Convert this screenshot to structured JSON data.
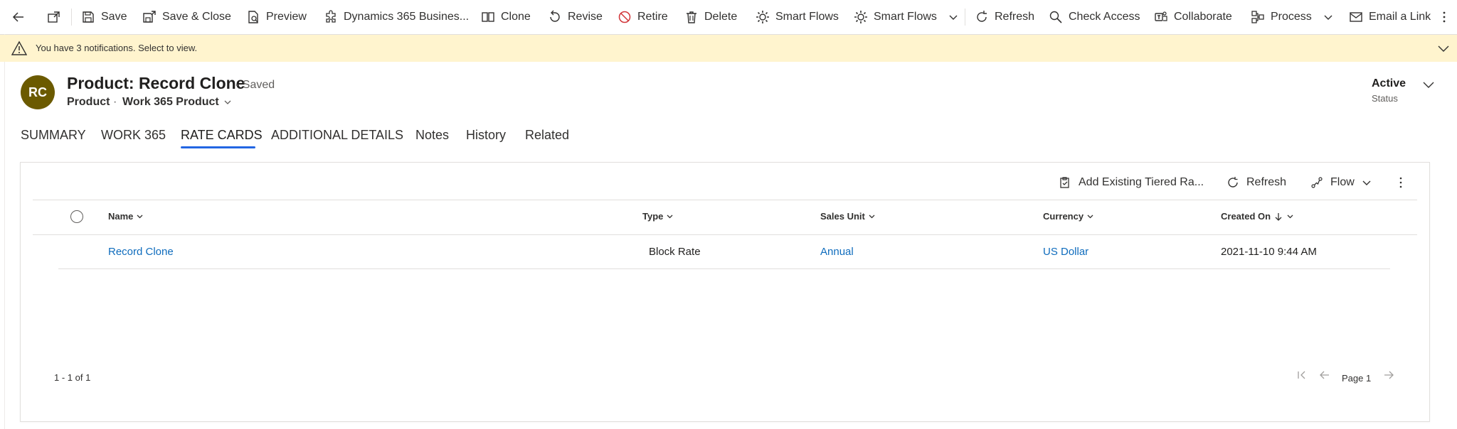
{
  "commands": [
    {
      "label": "Save",
      "icon": "save-icon"
    },
    {
      "label": "Save & Close",
      "icon": "save-close-icon"
    },
    {
      "label": "Preview",
      "icon": "preview-icon"
    },
    {
      "label": "Dynamics 365 Busines...",
      "icon": "puzzle-icon"
    },
    {
      "label": "Clone",
      "icon": "clone-icon"
    },
    {
      "label": "Revise",
      "icon": "revise-icon"
    },
    {
      "label": "Retire",
      "icon": "retire-icon"
    },
    {
      "label": "Delete",
      "icon": "delete-icon"
    },
    {
      "label": "Smart Flows",
      "icon": "smart-flows-icon"
    },
    {
      "label": "Smart Flows",
      "icon": "smart-flows-icon"
    },
    {
      "label": "Refresh",
      "icon": "refresh-icon"
    },
    {
      "label": "Check Access",
      "icon": "check-access-icon"
    },
    {
      "label": "Collaborate",
      "icon": "collaborate-icon"
    },
    {
      "label": "Process",
      "icon": "process-icon"
    },
    {
      "label": "Email a Link",
      "icon": "email-icon"
    }
  ],
  "notification": {
    "text": "You have 3 notifications. Select to view."
  },
  "record": {
    "avatar_initials": "RC",
    "title": "Product: Record Clone",
    "saved_state": "- Saved",
    "entity": "Product",
    "separator": "·",
    "form_name": "Work 365 Product",
    "status_value": "Active",
    "status_label": "Status"
  },
  "tabs": [
    {
      "label": "SUMMARY"
    },
    {
      "label": "WORK 365"
    },
    {
      "label": "RATE CARDS",
      "active": true
    },
    {
      "label": "ADDITIONAL DETAILS"
    },
    {
      "label": "Notes"
    },
    {
      "label": "History"
    },
    {
      "label": "Related"
    }
  ],
  "grid": {
    "toolbar": {
      "add_existing": "Add Existing Tiered Ra...",
      "refresh": "Refresh",
      "flow": "Flow"
    },
    "columns": [
      "Name",
      "Type",
      "Sales Unit",
      "Currency",
      "Created On"
    ],
    "rows": [
      {
        "name": "Record Clone",
        "type": "Block Rate",
        "sales_unit": "Annual",
        "currency": "US Dollar",
        "created_on": "2021-11-10 9:44 AM"
      }
    ],
    "record_count": "1 - 1 of 1",
    "page_label": "Page 1"
  },
  "colors": {
    "accent": "#2266e3",
    "link": "#0f6cbd",
    "notification_bg": "#fff4ce",
    "avatar_bg": "#6b5a00"
  }
}
